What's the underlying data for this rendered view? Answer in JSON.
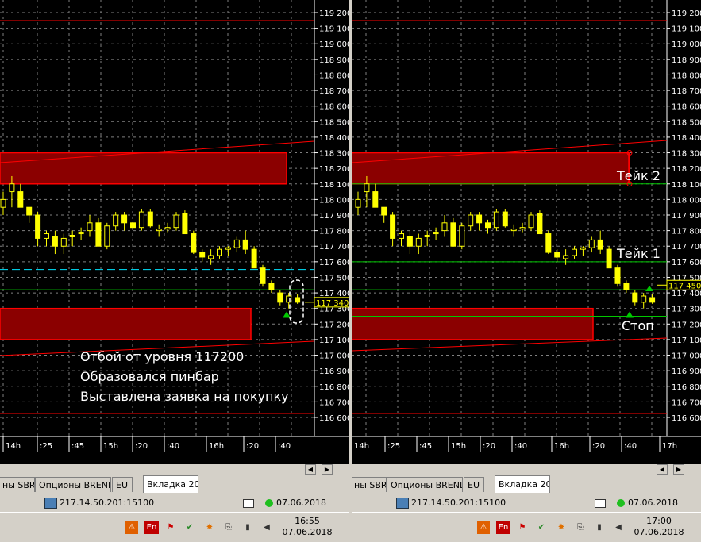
{
  "colors": {
    "background": "#000000",
    "grid": "#808080",
    "candle_bull": "#ffff00",
    "candle_bear": "#ffff00",
    "zone_fill": "#8b0000",
    "zone_border": "#ff0000",
    "green_line": "#00c800",
    "cyan_line": "#00ffff",
    "trend_line": "#ff0000"
  },
  "axis": {
    "ticks": [
      "119 200",
      "119 100",
      "119 000",
      "118 900",
      "118 800",
      "118 700",
      "118 600",
      "118 500",
      "118 400",
      "118 300",
      "118 200",
      "118 100",
      "118 000",
      "117 900",
      "117 800",
      "117 700",
      "117 600",
      "117 500",
      "117 400",
      "117 300",
      "117 200",
      "117 100",
      "117 000",
      "116 900",
      "116 800",
      "116 700",
      "116 600"
    ]
  },
  "left": {
    "xticks": [
      "14h",
      ":25",
      ":45",
      "15h",
      ":20",
      ":40",
      "16h",
      ":20",
      ":40"
    ],
    "price_tag": "117 340",
    "annotations": [
      "Отбой от  уровня 117200",
      "Образовался пинбар",
      "Выставлена заявка на покупку"
    ],
    "tabs": [
      "ны SBR",
      "Опционы BREND",
      "EU",
      "Вкладка 20"
    ],
    "active_tab": 3,
    "server": "217.14.50.201:15100",
    "date": "07.06.2018",
    "clock_time": "16:55",
    "clock_date": "07.06.2018"
  },
  "right": {
    "xticks": [
      "14h",
      ":25",
      ":45",
      "15h",
      ":20",
      ":40",
      "16h",
      ":20",
      ":40",
      "17h"
    ],
    "price_tag": "117 450",
    "labels": {
      "take2": "Тейк 2",
      "take1": "Тейк 1",
      "stop": "Стоп"
    },
    "tabs": [
      "ны SBR",
      "Опционы BREND",
      "EU",
      "Вкладка 20"
    ],
    "active_tab": 3,
    "server": "217.14.50.201:15100",
    "date": "07.06.2018",
    "clock_time": "17:00",
    "clock_date": "07.06.2018"
  },
  "tray": {
    "lang": "En"
  },
  "chart_data": [
    {
      "type": "candlestick",
      "title": "",
      "price_range": [
        116600,
        119200
      ],
      "resistance_zone": [
        118100,
        118300
      ],
      "support_zone": [
        117100,
        117300
      ],
      "cyan_level": 117550,
      "green_level": 117420,
      "last_price": 117340,
      "candles": [
        {
          "o": 117950,
          "h": 118050,
          "l": 117900,
          "c": 118000
        },
        {
          "o": 118050,
          "h": 118150,
          "l": 117950,
          "c": 118100
        },
        {
          "o": 118050,
          "h": 118100,
          "l": 117950,
          "c": 117950
        },
        {
          "o": 117950,
          "h": 117950,
          "l": 117850,
          "c": 117900
        },
        {
          "o": 117900,
          "h": 117920,
          "l": 117700,
          "c": 117750
        },
        {
          "o": 117750,
          "h": 117800,
          "l": 117700,
          "c": 117780
        },
        {
          "o": 117760,
          "h": 117800,
          "l": 117650,
          "c": 117700
        },
        {
          "o": 117700,
          "h": 117780,
          "l": 117650,
          "c": 117750
        },
        {
          "o": 117760,
          "h": 117800,
          "l": 117700,
          "c": 117770
        },
        {
          "o": 117780,
          "h": 117820,
          "l": 117740,
          "c": 117790
        },
        {
          "o": 117800,
          "h": 117900,
          "l": 117760,
          "c": 117850
        },
        {
          "o": 117850,
          "h": 117880,
          "l": 117700,
          "c": 117700
        },
        {
          "o": 117700,
          "h": 117850,
          "l": 117680,
          "c": 117830
        },
        {
          "o": 117830,
          "h": 117920,
          "l": 117800,
          "c": 117900
        },
        {
          "o": 117900,
          "h": 117920,
          "l": 117800,
          "c": 117850
        },
        {
          "o": 117850,
          "h": 117870,
          "l": 117780,
          "c": 117820
        },
        {
          "o": 117820,
          "h": 117940,
          "l": 117800,
          "c": 117920
        },
        {
          "o": 117920,
          "h": 117940,
          "l": 117820,
          "c": 117830
        },
        {
          "o": 117800,
          "h": 117840,
          "l": 117760,
          "c": 117810
        },
        {
          "o": 117810,
          "h": 117850,
          "l": 117790,
          "c": 117820
        },
        {
          "o": 117820,
          "h": 117920,
          "l": 117800,
          "c": 117900
        },
        {
          "o": 117910,
          "h": 117930,
          "l": 117780,
          "c": 117780
        },
        {
          "o": 117780,
          "h": 117800,
          "l": 117650,
          "c": 117660
        },
        {
          "o": 117660,
          "h": 117680,
          "l": 117600,
          "c": 117630
        },
        {
          "o": 117620,
          "h": 117680,
          "l": 117580,
          "c": 117640
        },
        {
          "o": 117640,
          "h": 117700,
          "l": 117620,
          "c": 117680
        },
        {
          "o": 117680,
          "h": 117700,
          "l": 117640,
          "c": 117690
        },
        {
          "o": 117690,
          "h": 117760,
          "l": 117660,
          "c": 117740
        },
        {
          "o": 117740,
          "h": 117800,
          "l": 117650,
          "c": 117680
        },
        {
          "o": 117680,
          "h": 117700,
          "l": 117560,
          "c": 117560
        },
        {
          "o": 117560,
          "h": 117580,
          "l": 117440,
          "c": 117460
        },
        {
          "o": 117460,
          "h": 117480,
          "l": 117400,
          "c": 117420
        },
        {
          "o": 117400,
          "h": 117420,
          "l": 117320,
          "c": 117340
        },
        {
          "o": 117340,
          "h": 117400,
          "l": 117300,
          "c": 117380
        },
        {
          "o": 117370,
          "h": 117390,
          "l": 117330,
          "c": 117340
        }
      ]
    }
  ]
}
